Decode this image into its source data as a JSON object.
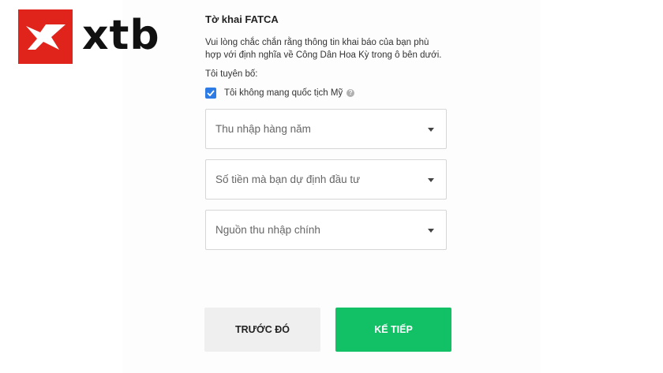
{
  "brand": {
    "logo_icon": "xtb-x-icon",
    "name": "xtb",
    "color": "#e1241b"
  },
  "form": {
    "title": "Tờ khai FATCA",
    "description_line1": "Vui lòng chắc chắn rằng thông tin khai báo của bạn phù",
    "description_line2": "hợp với định nghĩa về Công Dân Hoa Kỳ trong ô bên dưới.",
    "declare_label": "Tôi tuyên bố:",
    "checkbox_label": "Tôi không mang quốc tịch Mỹ",
    "checkbox_checked": true,
    "help_icon": "?",
    "selects": [
      {
        "placeholder": "Thu nhập hàng năm"
      },
      {
        "placeholder": "Số tiền mà bạn dự định đầu tư"
      },
      {
        "placeholder": "Nguồn thu nhập chính"
      }
    ]
  },
  "buttons": {
    "back_label": "TRƯỚC ĐÓ",
    "next_label": "KẾ TIẾP",
    "next_color": "#12c165",
    "checkbox_color": "#2d7be5"
  }
}
